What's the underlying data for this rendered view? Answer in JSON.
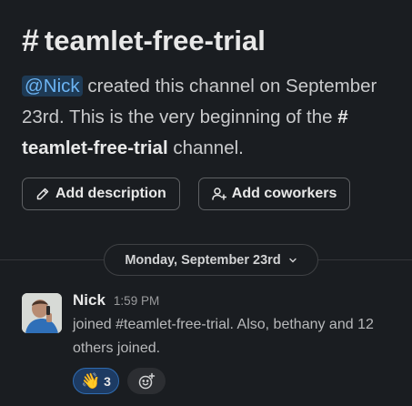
{
  "channel": {
    "hash": "#",
    "name": "teamlet-free-trial"
  },
  "intro": {
    "mention": "@Nick",
    "text_1": " created this channel on September 23rd. This is the very beginning of the ",
    "channel_hash": "#",
    "channel_name": "teamlet-free-trial",
    "text_2": " channel."
  },
  "actions": {
    "add_description": "Add description",
    "add_coworkers": "Add coworkers"
  },
  "date_divider": {
    "label": "Monday, September 23rd"
  },
  "message": {
    "author": "Nick",
    "time": "1:59 PM",
    "text": "joined #teamlet-free-trial. Also, bethany and 12 others joined."
  },
  "reactions": [
    {
      "emoji": "👋",
      "count": "3"
    }
  ],
  "colors": {
    "background": "#1a1d21",
    "mention_bg": "#1e3a55",
    "mention_text": "#6cb4f3",
    "reaction_bg": "#1d3b63"
  }
}
